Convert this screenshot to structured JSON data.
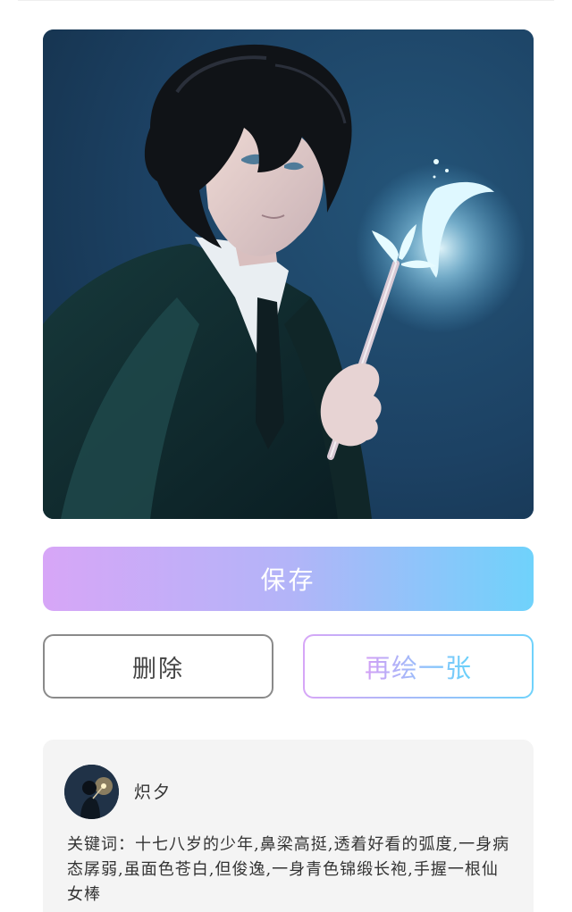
{
  "artwork": {
    "description_icon": "generated-artwork-image",
    "colors": {
      "background": "#1d3f5f",
      "glow": "#bfefff",
      "robe": "#0f2b2c"
    }
  },
  "actions": {
    "save_label": "保存",
    "delete_label": "删除",
    "redraw_label": "再绘一张"
  },
  "colors": {
    "accent_start": "#d7a6f7",
    "accent_end": "#6fd2fb",
    "card_bg": "#f4f4f4",
    "delete_border": "#8a8a8a"
  },
  "author": {
    "avatar_icon": "user-avatar-image",
    "name": "炽夕"
  },
  "prompt": {
    "text": "关键词：十七八岁的少年,鼻梁高挺,透着好看的弧度,一身病态孱弱,虽面色苍白,但俊逸,一身青色锦缎长袍,手握一根仙女棒"
  }
}
